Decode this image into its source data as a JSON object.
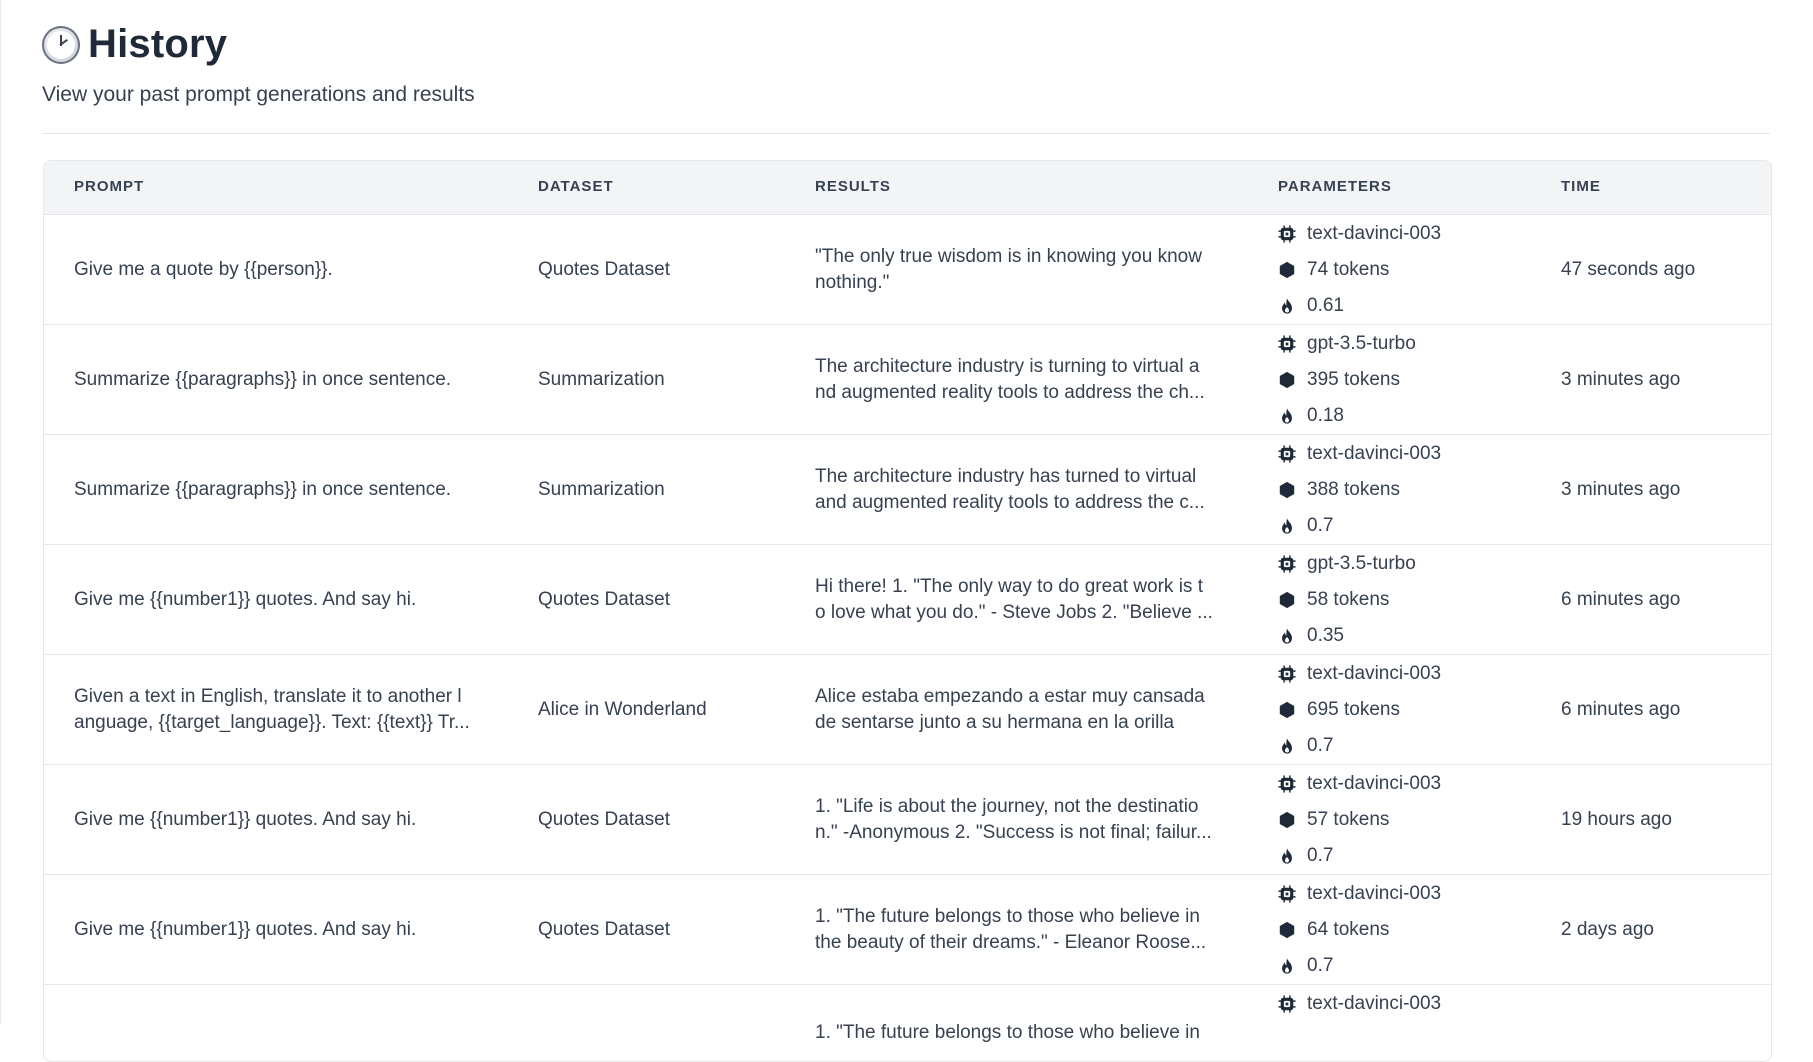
{
  "page": {
    "title": "History",
    "subtitle": "View your past prompt generations and results",
    "title_icon": "clock-icon"
  },
  "table": {
    "headers": {
      "prompt": "PROMPT",
      "dataset": "DATASET",
      "results": "RESULTS",
      "parameters": "PARAMETERS",
      "time": "TIME"
    },
    "rows": [
      {
        "prompt": "Give me a quote by {{person}}.",
        "dataset": "Quotes Dataset",
        "results": "\"The only true wisdom is in knowing you know nothing.\"",
        "model": "text-davinci-003",
        "tokens": "74 tokens",
        "temperature": "0.61",
        "time": "47 seconds ago"
      },
      {
        "prompt": "Summarize {{paragraphs}} in once sentence.",
        "dataset": "Summarization",
        "results": "The architecture industry is turning to virtual a nd augmented reality tools to address the ch...",
        "model": "gpt-3.5-turbo",
        "tokens": "395 tokens",
        "temperature": "0.18",
        "time": "3 minutes ago"
      },
      {
        "prompt": "Summarize {{paragraphs}} in once sentence.",
        "dataset": "Summarization",
        "results": "The architecture industry has turned to virtual and augmented reality tools to address the c...",
        "model": "text-davinci-003",
        "tokens": "388 tokens",
        "temperature": "0.7",
        "time": "3 minutes ago"
      },
      {
        "prompt": "Give me {{number1}} quotes. And say hi.",
        "dataset": "Quotes Dataset",
        "results": "Hi there! 1. \"The only way to do great work is t o love what you do.\" - Steve Jobs 2. \"Believe ...",
        "model": "gpt-3.5-turbo",
        "tokens": "58 tokens",
        "temperature": "0.35",
        "time": "6 minutes ago"
      },
      {
        "prompt": "Given a text in English, translate it to another l anguage, {{target_language}}. Text: {{text}} Tr...",
        "dataset": "Alice in Wonderland",
        "results": "Alice estaba empezando a estar muy cansada de sentarse junto a su hermana en la orilla",
        "model": "text-davinci-003",
        "tokens": "695 tokens",
        "temperature": "0.7",
        "time": "6 minutes ago"
      },
      {
        "prompt": "Give me {{number1}} quotes. And say hi.",
        "dataset": "Quotes Dataset",
        "results": "1. \"Life is about the journey, not the destinatio n.\" -Anonymous 2. \"Success is not final; failur...",
        "model": "text-davinci-003",
        "tokens": "57 tokens",
        "temperature": "0.7",
        "time": "19 hours ago"
      },
      {
        "prompt": "Give me {{number1}} quotes. And say hi.",
        "dataset": "Quotes Dataset",
        "results": "1. \"The future belongs to those who believe in the beauty of their dreams.\" - Eleanor Roose...",
        "model": "text-davinci-003",
        "tokens": "64 tokens",
        "temperature": "0.7",
        "time": "2 days ago"
      },
      {
        "prompt": "",
        "dataset": "",
        "results": "1. \"The future belongs to those who believe in",
        "model": "text-davinci-003",
        "tokens": "",
        "temperature": "",
        "time": ""
      }
    ]
  },
  "icons": {
    "model": "chip-icon",
    "tokens": "hexagon-icon",
    "temperature": "flame-icon"
  },
  "colors": {
    "text": "#374151",
    "heading": "#1f2937",
    "header_bg": "#f3f4f6",
    "border": "#e5e7eb"
  }
}
